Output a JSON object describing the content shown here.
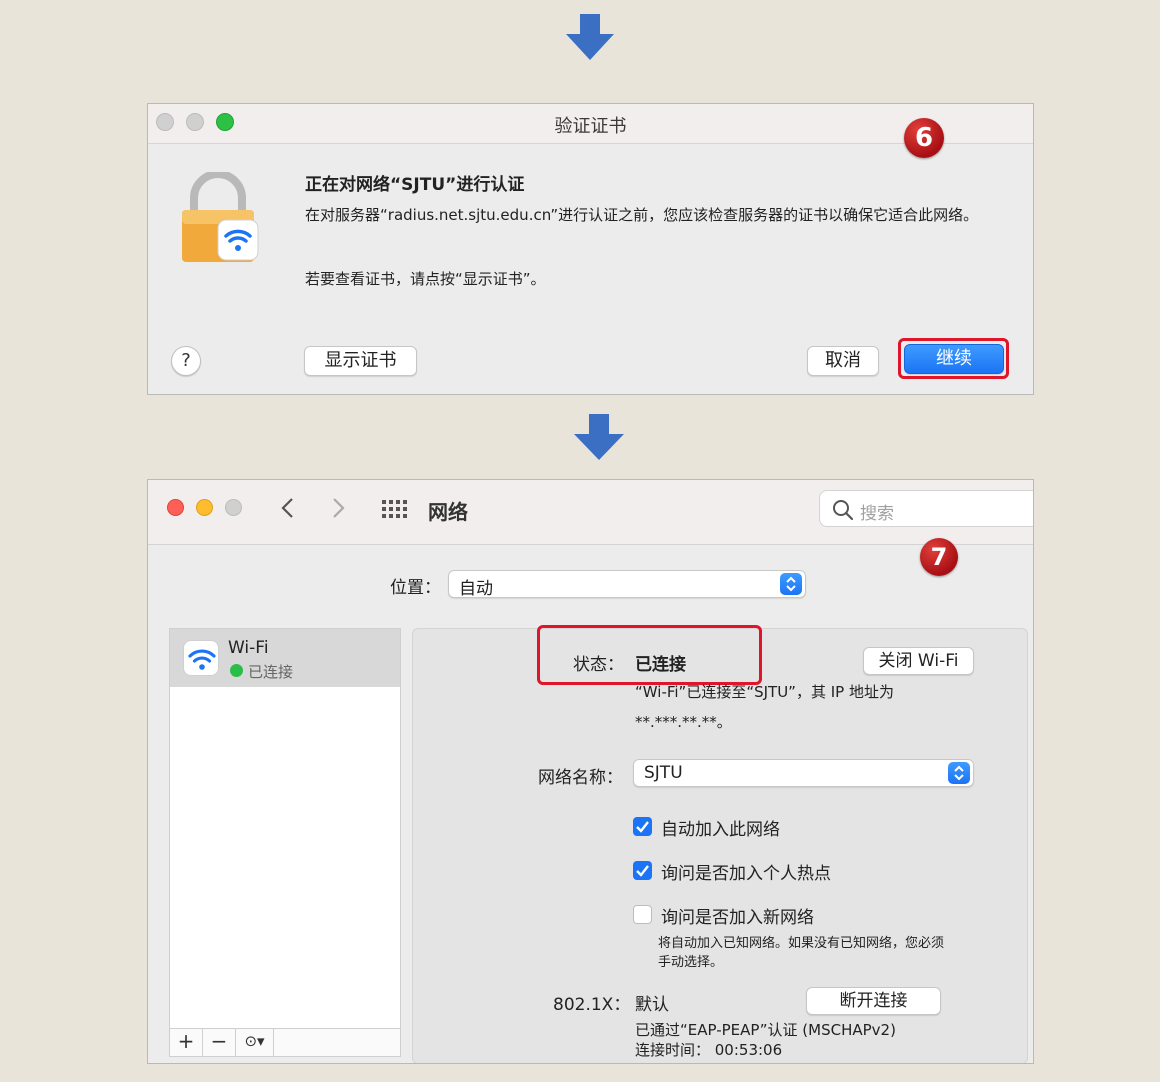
{
  "step_badges": {
    "dialog": "6",
    "network": "7"
  },
  "dialog": {
    "title": "验证证书",
    "heading": "正在对网络“SJTU”进行认证",
    "body": "在对服务器“radius.net.sjtu.edu.cn”进行认证之前，您应该检查服务器的证书以确保它适合此网络。",
    "hint": "若要查看证书，请点按“显示证书”。",
    "help_label": "?",
    "show_cert_label": "显示证书",
    "cancel_label": "取消",
    "continue_label": "继续"
  },
  "network": {
    "title": "网络",
    "search_placeholder": "搜索",
    "location_label": "位置：",
    "location_value": "自动",
    "sidebar": {
      "items": [
        {
          "name": "Wi-Fi",
          "status": "已连接"
        }
      ],
      "footer": {
        "add": "+",
        "remove": "−",
        "more": "⊙▾"
      }
    },
    "status_label": "状态：",
    "status_value": "已连接",
    "turn_off_label": "关闭 Wi-Fi",
    "status_detail": "“Wi-Fi”已连接至“SJTU”，其 IP 地址为",
    "ip_masked": "**.***.**.**。",
    "network_name_label": "网络名称：",
    "network_name_value": "SJTU",
    "checkboxes": [
      {
        "label": "自动加入此网络",
        "checked": true
      },
      {
        "label": "询问是否加入个人热点",
        "checked": true
      },
      {
        "label": "询问是否加入新网络",
        "checked": false
      }
    ],
    "new_network_note_1": "将自动加入已知网络。如果没有已知网络，您必须",
    "new_network_note_2": "手动选择。",
    "dot1x_label": "802.1X：",
    "dot1x_value": "默认",
    "disconnect_label": "断开连接",
    "auth_detail": "已通过“EAP-PEAP”认证 (MSCHAPv2)",
    "connect_time": "连接时间：  00:53:06"
  },
  "colors": {
    "primary_blue": "#1b74f5",
    "highlight_red": "#e0142a",
    "badge_red": "#b3151a",
    "arrow_blue": "#3a6fc4"
  }
}
